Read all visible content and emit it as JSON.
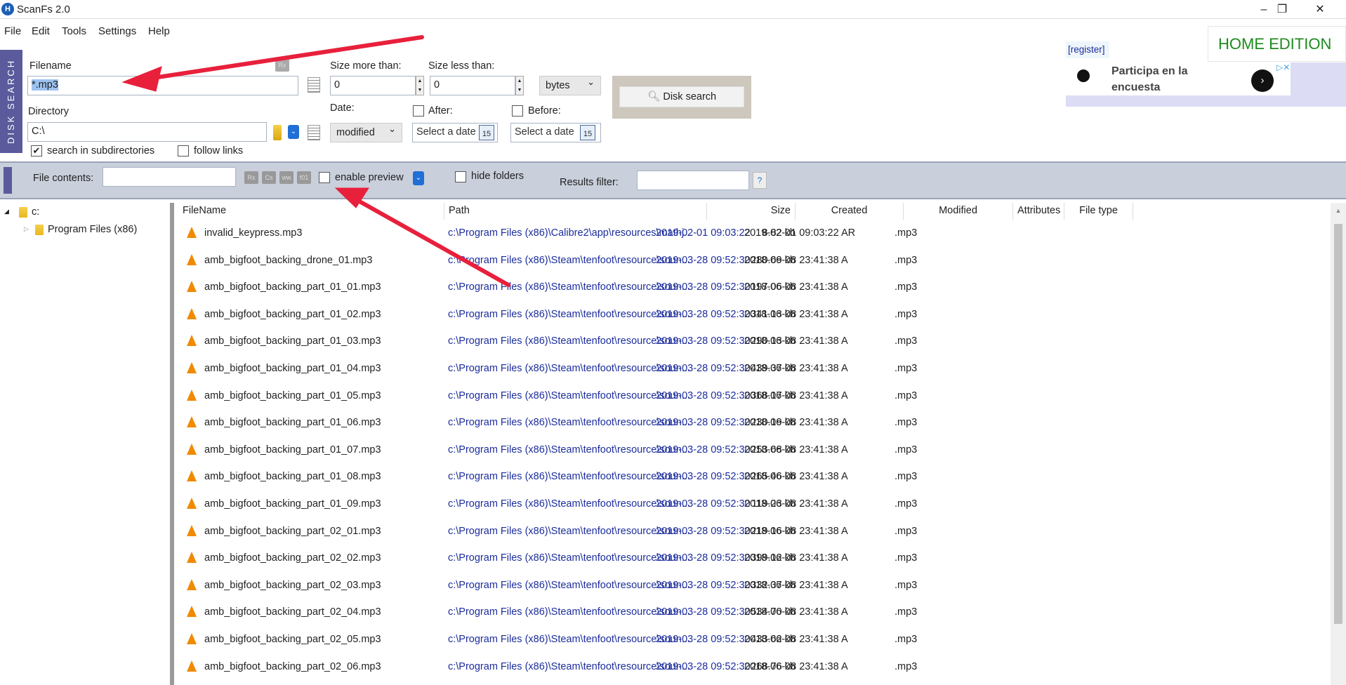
{
  "window": {
    "title": "ScanFs 2.0",
    "icon": "app-logo-icon"
  },
  "menu": [
    "File",
    "Edit",
    "Tools",
    "Settings",
    "Help"
  ],
  "side_tab": "DISK SEARCH",
  "search": {
    "filename_label": "Filename",
    "filename_value": "*.mp3",
    "rx_label": "Rx",
    "directory_label": "Directory",
    "directory_value": "C:\\",
    "subdirs_label": "search in subdirectories",
    "subdirs_checked": true,
    "follow_links_label": "follow links",
    "follow_links_checked": false,
    "size_more_label": "Size more than:",
    "size_more_value": "0",
    "size_less_label": "Size less than:",
    "size_less_value": "0",
    "size_unit": "bytes",
    "date_label": "Date:",
    "date_type": "modified",
    "after_label": "After:",
    "before_label": "Before:",
    "date_placeholder": "Select a date",
    "cal_day": "15",
    "disk_search_button": "Disk search"
  },
  "register": "[register]",
  "edition": "HOME EDITION",
  "ad": {
    "text1": "Participa en la",
    "text2": "encuesta"
  },
  "filters": {
    "file_contents_label": "File contents:",
    "file_contents_value": "",
    "mini_buttons": [
      "Rx",
      "Cs",
      "ww",
      "f01"
    ],
    "enable_preview_label": "enable preview",
    "hide_folders_label": "hide folders",
    "results_filter_label": "Results filter:",
    "results_filter_value": "",
    "help_button": "?"
  },
  "tree": {
    "root": "c:",
    "child": "Program Files (x86)"
  },
  "columns": [
    "FileName",
    "Path",
    "Size",
    "Created",
    "Modified",
    "Attributes",
    "File type"
  ],
  "rows": [
    [
      "invalid_keypress.mp3",
      "c:\\Program Files (x86)\\Calibre2\\app\\resources\\mathj...",
      "8.82 kb",
      "2019-02-01 09:03:22",
      "2019-02-01 09:03:22",
      "AR",
      ".mp3"
    ],
    [
      "amb_bigfoot_backing_drone_01.mp3",
      "c:\\Program Files (x86)\\Steam\\tenfoot\\resource\\soun...",
      "280.69 kb",
      "2019-03-28 09:52:30",
      "2018-06-08 23:41:38",
      "A",
      ".mp3"
    ],
    [
      "amb_bigfoot_backing_part_01_01.mp3",
      "c:\\Program Files (x86)\\Steam\\tenfoot\\resource\\soun...",
      "197.06 kb",
      "2019-03-28 09:52:30",
      "2018-06-08 23:41:38",
      "A",
      ".mp3"
    ],
    [
      "amb_bigfoot_backing_part_01_02.mp3",
      "c:\\Program Files (x86)\\Steam\\tenfoot\\resource\\soun...",
      "341.13 kb",
      "2019-03-28 09:52:30",
      "2018-06-08 23:41:38",
      "A",
      ".mp3"
    ],
    [
      "amb_bigfoot_backing_part_01_03.mp3",
      "c:\\Program Files (x86)\\Steam\\tenfoot\\resource\\soun...",
      "290.13 kb",
      "2019-03-28 09:52:30",
      "2018-06-08 23:41:38",
      "A",
      ".mp3"
    ],
    [
      "amb_bigfoot_backing_part_01_04.mp3",
      "c:\\Program Files (x86)\\Steam\\tenfoot\\resource\\soun...",
      "439.37 kb",
      "2019-03-28 09:52:30",
      "2018-06-08 23:41:38",
      "A",
      ".mp3"
    ],
    [
      "amb_bigfoot_backing_part_01_05.mp3",
      "c:\\Program Files (x86)\\Steam\\tenfoot\\resource\\soun...",
      "368.17 kb",
      "2019-03-28 09:52:30",
      "2018-06-08 23:41:38",
      "A",
      ".mp3"
    ],
    [
      "amb_bigfoot_backing_part_01_06.mp3",
      "c:\\Program Files (x86)\\Steam\\tenfoot\\resource\\soun...",
      "230.19 kb",
      "2019-03-28 09:52:30",
      "2018-06-08 23:41:38",
      "A",
      ".mp3"
    ],
    [
      "amb_bigfoot_backing_part_01_07.mp3",
      "c:\\Program Files (x86)\\Steam\\tenfoot\\resource\\soun...",
      "253.68 kb",
      "2019-03-28 09:52:30",
      "2018-06-08 23:41:38",
      "A",
      ".mp3"
    ],
    [
      "amb_bigfoot_backing_part_01_08.mp3",
      "c:\\Program Files (x86)\\Steam\\tenfoot\\resource\\soun...",
      "265.46 kb",
      "2019-03-28 09:52:30",
      "2018-06-08 23:41:38",
      "A",
      ".mp3"
    ],
    [
      "amb_bigfoot_backing_part_01_09.mp3",
      "c:\\Program Files (x86)\\Steam\\tenfoot\\resource\\soun...",
      "119.23 kb",
      "2019-03-28 09:52:30",
      "2018-06-08 23:41:38",
      "A",
      ".mp3"
    ],
    [
      "amb_bigfoot_backing_part_02_01.mp3",
      "c:\\Program Files (x86)\\Steam\\tenfoot\\resource\\soun...",
      "219.16 kb",
      "2019-03-28 09:52:30",
      "2018-06-08 23:41:38",
      "A",
      ".mp3"
    ],
    [
      "amb_bigfoot_backing_part_02_02.mp3",
      "c:\\Program Files (x86)\\Steam\\tenfoot\\resource\\soun...",
      "399.12 kb",
      "2019-03-28 09:52:30",
      "2018-06-08 23:41:38",
      "A",
      ".mp3"
    ],
    [
      "amb_bigfoot_backing_part_02_03.mp3",
      "c:\\Program Files (x86)\\Steam\\tenfoot\\resource\\soun...",
      "332.37 kb",
      "2019-03-28 09:52:30",
      "2018-06-08 23:41:38",
      "A",
      ".mp3"
    ],
    [
      "amb_bigfoot_backing_part_02_04.mp3",
      "c:\\Program Files (x86)\\Steam\\tenfoot\\resource\\soun...",
      "534.70 kb",
      "2019-03-28 09:52:30",
      "2018-06-08 23:41:38",
      "A",
      ".mp3"
    ],
    [
      "amb_bigfoot_backing_part_02_05.mp3",
      "c:\\Program Files (x86)\\Steam\\tenfoot\\resource\\soun...",
      "433.62 kb",
      "2019-03-28 09:52:30",
      "2018-06-08 23:41:38",
      "A",
      ".mp3"
    ],
    [
      "amb_bigfoot_backing_part_02_06.mp3",
      "c:\\Program Files (x86)\\Steam\\tenfoot\\resource\\soun...",
      "268.76 kb",
      "2019-03-28 09:52:30",
      "2018-06-08 23:41:38",
      "A",
      ".mp3"
    ]
  ],
  "colors": {
    "accent": "#5a5a9c",
    "edition": "#1f8a1f",
    "link": "#1c2d9c",
    "arrow": "#e8203c"
  }
}
